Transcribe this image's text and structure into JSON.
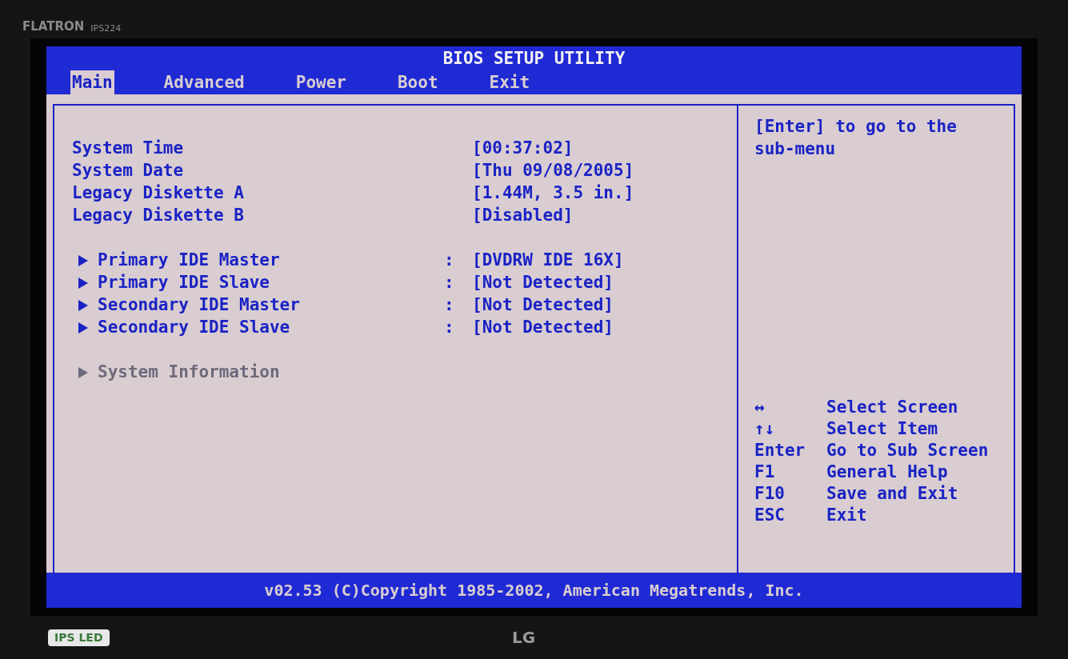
{
  "monitor": {
    "brand": "FLATRON",
    "model": "IPS224",
    "badge": "IPS LED",
    "logo": "LG"
  },
  "window": {
    "title": "BIOS SETUP UTILITY"
  },
  "tabs": [
    {
      "label": "Main",
      "selected": true
    },
    {
      "label": "Advanced",
      "selected": false
    },
    {
      "label": "Power",
      "selected": false
    },
    {
      "label": "Boot",
      "selected": false
    },
    {
      "label": "Exit",
      "selected": false
    }
  ],
  "groups": [
    [
      {
        "kind": "field",
        "label": "System Time",
        "value": "[00:37:02]",
        "selected": false
      },
      {
        "kind": "field",
        "label": "System Date",
        "value": "[Thu 09/08/2005]",
        "selected": false
      },
      {
        "kind": "field",
        "label": "Legacy Diskette A",
        "value": "[1.44M, 3.5 in.]",
        "selected": false
      },
      {
        "kind": "field",
        "label": "Legacy Diskette B",
        "value": "[Disabled]",
        "selected": false
      }
    ],
    [
      {
        "kind": "submenu",
        "label": "Primary IDE Master",
        "separator": ":",
        "value": "[DVDRW IDE 16X]",
        "selected": false
      },
      {
        "kind": "submenu",
        "label": "Primary IDE Slave",
        "separator": ":",
        "value": "[Not Detected]",
        "selected": false
      },
      {
        "kind": "submenu",
        "label": "Secondary IDE Master",
        "separator": ":",
        "value": "[Not Detected]",
        "selected": false
      },
      {
        "kind": "submenu",
        "label": "Secondary IDE Slave",
        "separator": ":",
        "value": "[Not Detected]",
        "selected": false
      }
    ],
    [
      {
        "kind": "submenu",
        "label": "System Information",
        "selected": true
      }
    ]
  ],
  "help": {
    "text": "[Enter] to go to the sub-menu"
  },
  "keys": [
    {
      "key": "↔",
      "action": "Select Screen"
    },
    {
      "key": "↑↓",
      "action": "Select Item"
    },
    {
      "key": "Enter",
      "action": "Go to Sub Screen"
    },
    {
      "key": "F1",
      "action": "General Help"
    },
    {
      "key": "F10",
      "action": "Save and Exit"
    },
    {
      "key": "ESC",
      "action": "Exit"
    }
  ],
  "footer": "v02.53 (C)Copyright 1985-2002, American Megatrends, Inc."
}
